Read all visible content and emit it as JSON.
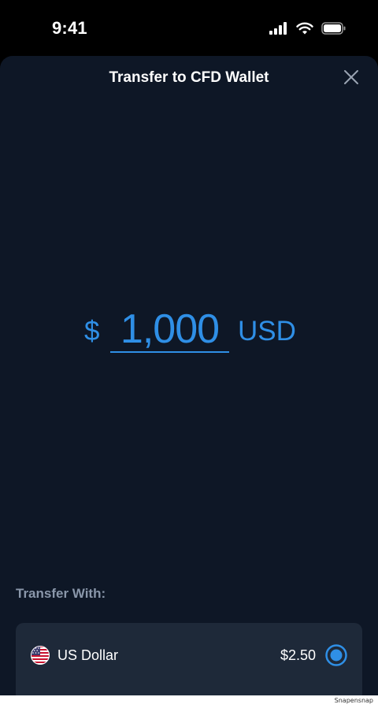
{
  "status_bar": {
    "time": "9:41"
  },
  "sheet": {
    "title": "Transfer to CFD Wallet"
  },
  "amount": {
    "symbol": "$",
    "value": "1,000",
    "currency": "USD"
  },
  "transfer_with": {
    "label": "Transfer With:",
    "options": [
      {
        "name": "US Dollar",
        "balance": "$2.50",
        "selected": true,
        "icon": "us-flag-icon"
      }
    ]
  },
  "watermark": "Snapensnap",
  "colors": {
    "background": "#000000",
    "sheet": "#0e1726",
    "card": "#1e2939",
    "accent": "#2f8fe6",
    "muted_text": "#8a97aa",
    "text": "#ffffff"
  }
}
